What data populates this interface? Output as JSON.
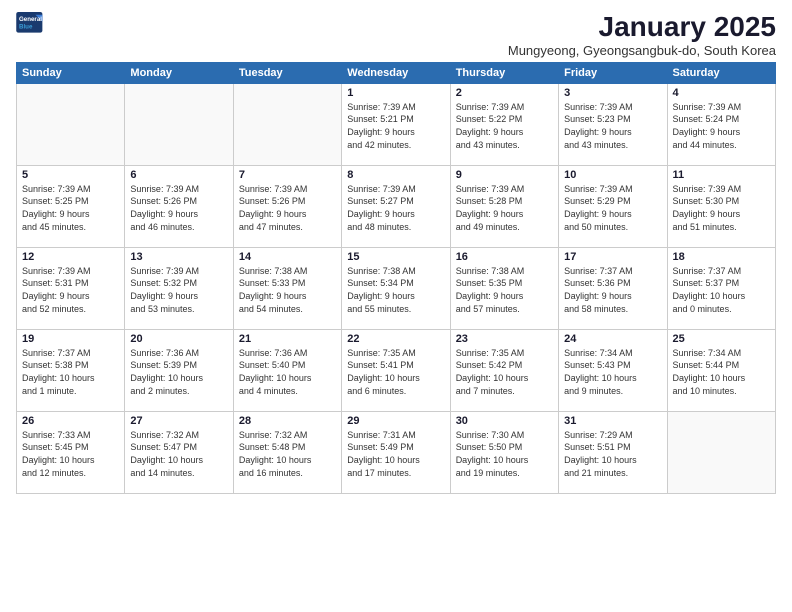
{
  "logo": {
    "line1": "General",
    "line2": "Blue"
  },
  "title": "January 2025",
  "subtitle": "Mungyeong, Gyeongsangbuk-do, South Korea",
  "weekdays": [
    "Sunday",
    "Monday",
    "Tuesday",
    "Wednesday",
    "Thursday",
    "Friday",
    "Saturday"
  ],
  "weeks": [
    [
      {
        "day": "",
        "info": ""
      },
      {
        "day": "",
        "info": ""
      },
      {
        "day": "",
        "info": ""
      },
      {
        "day": "1",
        "info": "Sunrise: 7:39 AM\nSunset: 5:21 PM\nDaylight: 9 hours\nand 42 minutes."
      },
      {
        "day": "2",
        "info": "Sunrise: 7:39 AM\nSunset: 5:22 PM\nDaylight: 9 hours\nand 43 minutes."
      },
      {
        "day": "3",
        "info": "Sunrise: 7:39 AM\nSunset: 5:23 PM\nDaylight: 9 hours\nand 43 minutes."
      },
      {
        "day": "4",
        "info": "Sunrise: 7:39 AM\nSunset: 5:24 PM\nDaylight: 9 hours\nand 44 minutes."
      }
    ],
    [
      {
        "day": "5",
        "info": "Sunrise: 7:39 AM\nSunset: 5:25 PM\nDaylight: 9 hours\nand 45 minutes."
      },
      {
        "day": "6",
        "info": "Sunrise: 7:39 AM\nSunset: 5:26 PM\nDaylight: 9 hours\nand 46 minutes."
      },
      {
        "day": "7",
        "info": "Sunrise: 7:39 AM\nSunset: 5:26 PM\nDaylight: 9 hours\nand 47 minutes."
      },
      {
        "day": "8",
        "info": "Sunrise: 7:39 AM\nSunset: 5:27 PM\nDaylight: 9 hours\nand 48 minutes."
      },
      {
        "day": "9",
        "info": "Sunrise: 7:39 AM\nSunset: 5:28 PM\nDaylight: 9 hours\nand 49 minutes."
      },
      {
        "day": "10",
        "info": "Sunrise: 7:39 AM\nSunset: 5:29 PM\nDaylight: 9 hours\nand 50 minutes."
      },
      {
        "day": "11",
        "info": "Sunrise: 7:39 AM\nSunset: 5:30 PM\nDaylight: 9 hours\nand 51 minutes."
      }
    ],
    [
      {
        "day": "12",
        "info": "Sunrise: 7:39 AM\nSunset: 5:31 PM\nDaylight: 9 hours\nand 52 minutes."
      },
      {
        "day": "13",
        "info": "Sunrise: 7:39 AM\nSunset: 5:32 PM\nDaylight: 9 hours\nand 53 minutes."
      },
      {
        "day": "14",
        "info": "Sunrise: 7:38 AM\nSunset: 5:33 PM\nDaylight: 9 hours\nand 54 minutes."
      },
      {
        "day": "15",
        "info": "Sunrise: 7:38 AM\nSunset: 5:34 PM\nDaylight: 9 hours\nand 55 minutes."
      },
      {
        "day": "16",
        "info": "Sunrise: 7:38 AM\nSunset: 5:35 PM\nDaylight: 9 hours\nand 57 minutes."
      },
      {
        "day": "17",
        "info": "Sunrise: 7:37 AM\nSunset: 5:36 PM\nDaylight: 9 hours\nand 58 minutes."
      },
      {
        "day": "18",
        "info": "Sunrise: 7:37 AM\nSunset: 5:37 PM\nDaylight: 10 hours\nand 0 minutes."
      }
    ],
    [
      {
        "day": "19",
        "info": "Sunrise: 7:37 AM\nSunset: 5:38 PM\nDaylight: 10 hours\nand 1 minute."
      },
      {
        "day": "20",
        "info": "Sunrise: 7:36 AM\nSunset: 5:39 PM\nDaylight: 10 hours\nand 2 minutes."
      },
      {
        "day": "21",
        "info": "Sunrise: 7:36 AM\nSunset: 5:40 PM\nDaylight: 10 hours\nand 4 minutes."
      },
      {
        "day": "22",
        "info": "Sunrise: 7:35 AM\nSunset: 5:41 PM\nDaylight: 10 hours\nand 6 minutes."
      },
      {
        "day": "23",
        "info": "Sunrise: 7:35 AM\nSunset: 5:42 PM\nDaylight: 10 hours\nand 7 minutes."
      },
      {
        "day": "24",
        "info": "Sunrise: 7:34 AM\nSunset: 5:43 PM\nDaylight: 10 hours\nand 9 minutes."
      },
      {
        "day": "25",
        "info": "Sunrise: 7:34 AM\nSunset: 5:44 PM\nDaylight: 10 hours\nand 10 minutes."
      }
    ],
    [
      {
        "day": "26",
        "info": "Sunrise: 7:33 AM\nSunset: 5:45 PM\nDaylight: 10 hours\nand 12 minutes."
      },
      {
        "day": "27",
        "info": "Sunrise: 7:32 AM\nSunset: 5:47 PM\nDaylight: 10 hours\nand 14 minutes."
      },
      {
        "day": "28",
        "info": "Sunrise: 7:32 AM\nSunset: 5:48 PM\nDaylight: 10 hours\nand 16 minutes."
      },
      {
        "day": "29",
        "info": "Sunrise: 7:31 AM\nSunset: 5:49 PM\nDaylight: 10 hours\nand 17 minutes."
      },
      {
        "day": "30",
        "info": "Sunrise: 7:30 AM\nSunset: 5:50 PM\nDaylight: 10 hours\nand 19 minutes."
      },
      {
        "day": "31",
        "info": "Sunrise: 7:29 AM\nSunset: 5:51 PM\nDaylight: 10 hours\nand 21 minutes."
      },
      {
        "day": "",
        "info": ""
      }
    ]
  ]
}
